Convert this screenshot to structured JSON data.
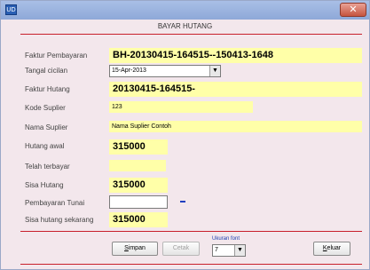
{
  "window": {
    "title": "BAYAR HUTANG",
    "close_symbol": "✕",
    "icon_text": "UD"
  },
  "form": {
    "faktur_pembayaran": {
      "label": "Faktur Pembayaran",
      "value": "BH-20130415-164515--150413-1648"
    },
    "tanggal_cicilan": {
      "label": "Tangal cicilan",
      "value": "15-Apr-2013"
    },
    "faktur_hutang": {
      "label": "Faktur Hutang",
      "value": "20130415-164515-"
    },
    "kode_suplier": {
      "label": "Kode Suplier",
      "value": "123"
    },
    "nama_suplier": {
      "label": "Nama Suplier",
      "value": "Nama Suplier Contoh"
    },
    "hutang_awal": {
      "label": "Hutang awal",
      "value": "315000"
    },
    "telah_terbayar": {
      "label": "Telah terbayar",
      "value": ""
    },
    "sisa_hutang": {
      "label": "Sisa Hutang",
      "value": "315000"
    },
    "pembayaran_tunai": {
      "label": "Pembayaran Tunai",
      "value": ""
    },
    "sisa_hutang_sekarang": {
      "label": "Sisa hutang sekarang",
      "value": "315000"
    }
  },
  "buttons": {
    "simpan": {
      "first": "S",
      "rest": "impan"
    },
    "cetak": {
      "label": "Cetak"
    },
    "keluar": {
      "first": "K",
      "rest": "eluar"
    }
  },
  "font_size": {
    "label": "Ukuran font",
    "value": "7"
  },
  "colors": {
    "field_bg": "#ffffa8",
    "window_bg": "#f3e7ec",
    "separator": "#c8202b",
    "title_bar": "#98b2df"
  }
}
